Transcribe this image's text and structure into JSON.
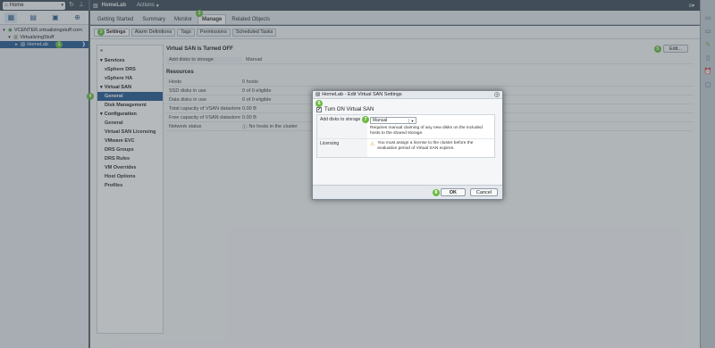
{
  "left_nav": {
    "home_label": "Home",
    "tree": [
      {
        "label": "VCENTER.virtualizingstuff.com",
        "level": 0
      },
      {
        "label": "VirtualizingStuff",
        "level": 1
      },
      {
        "label": "HomeLab",
        "level": 2,
        "badge": "1",
        "selected": true
      }
    ]
  },
  "header": {
    "title": "HomeLab",
    "actions_label": "Actions"
  },
  "main_tabs": [
    {
      "label": "Getting Started"
    },
    {
      "label": "Summary"
    },
    {
      "label": "Monitor"
    },
    {
      "label": "Manage",
      "badge": "2",
      "active": true
    },
    {
      "label": "Related Objects"
    }
  ],
  "sub_tabs": [
    {
      "label": "Settings",
      "badge": "3",
      "active": true
    },
    {
      "label": "Alarm Definitions"
    },
    {
      "label": "Tags"
    },
    {
      "label": "Permissions"
    },
    {
      "label": "Scheduled Tasks"
    }
  ],
  "settings_menu": {
    "back": "«",
    "groups": [
      {
        "title": "Services",
        "items": [
          "vSphere DRS",
          "vSphere HA"
        ]
      },
      {
        "title": "Virtual SAN",
        "items": [
          "General",
          "Disk Management"
        ],
        "active": "General",
        "badge": "4"
      },
      {
        "title": "Configuration",
        "items": [
          "General",
          "Virtual SAN Licensing",
          "VMware EVC",
          "DRS Groups",
          "DRS Rules",
          "VM Overrides",
          "Host Options",
          "Profiles"
        ]
      }
    ]
  },
  "detail": {
    "status_title": "Virtual SAN is Turned OFF",
    "edit_label": "Edit...",
    "edit_badge": "5",
    "add_disks_row": {
      "key": "Add disks to storage",
      "value": "Manual"
    },
    "resources_label": "Resources",
    "rows": [
      {
        "key": "Hosts",
        "value": "0 hosts"
      },
      {
        "key": "SSD disks in use",
        "value": "0 of 0 eligible"
      },
      {
        "key": "Data disks in use",
        "value": "0 of 0 eligible"
      },
      {
        "key": "Total capacity of VSAN datastore",
        "value": "0.00 B"
      },
      {
        "key": "Free capacity of VSAN datastore",
        "value": "0.00 B"
      },
      {
        "key": "Network status",
        "value": "No hosts in the cluster"
      }
    ]
  },
  "dialog": {
    "title": "HomeLab - Edit Virtual SAN Settings",
    "help": "?",
    "turn_on_label": "Turn ON Virtual SAN",
    "turn_on_badge": "6",
    "add_disks_key": "Add disks to storage",
    "add_disks_value": "Manual",
    "add_disks_badge": "7",
    "add_disks_desc": "Requires manual claiming of any new disks on the included hosts to the shared storage.",
    "licensing_key": "Licensing",
    "licensing_text": "You must assign a license to the cluster before the evaluation period of Virtual SAN expires.",
    "ok_label": "OK",
    "ok_badge": "8",
    "cancel_label": "Cancel"
  },
  "colors": {
    "badge_green": "#6cbb44",
    "selection_blue": "#2d5e95",
    "header_dark": "#44515e"
  }
}
